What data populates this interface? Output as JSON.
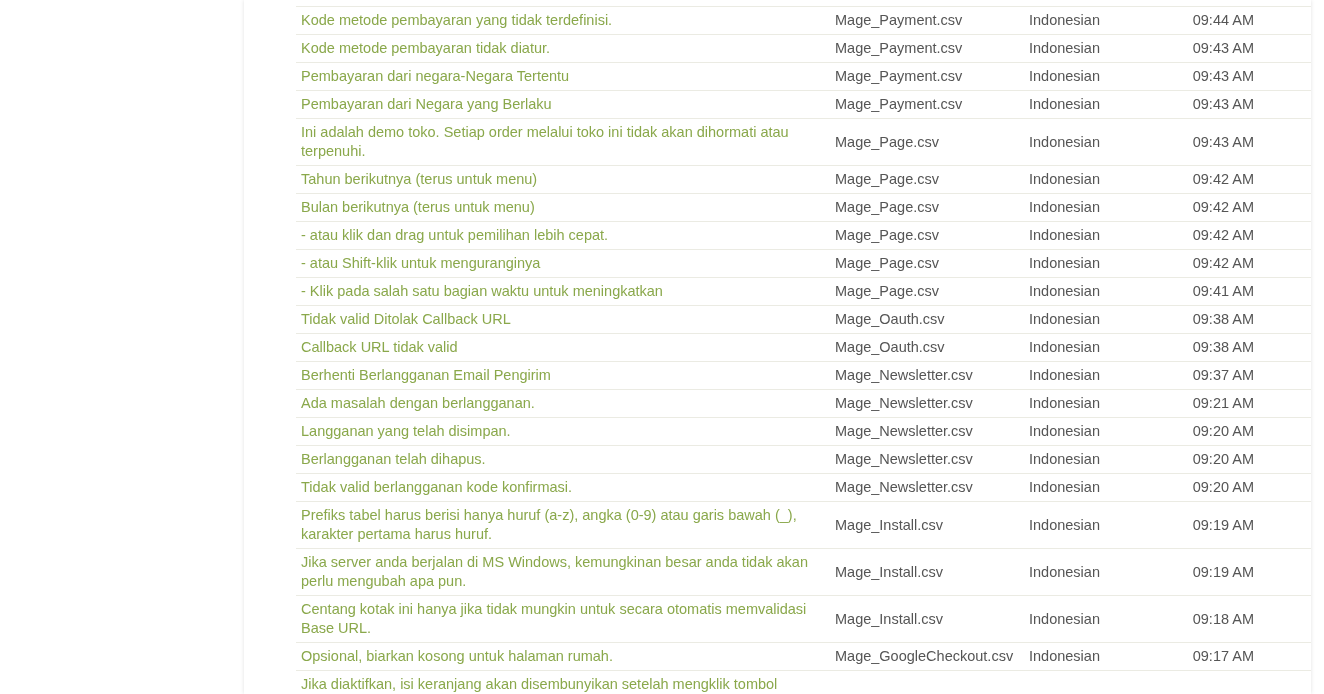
{
  "table": {
    "rows": [
      {
        "text": "Kode metode pembayaran yang tidak terdefinisi.",
        "file": "Mage_Payment.csv",
        "language": "Indonesian",
        "time": "09:44 AM"
      },
      {
        "text": "Kode metode pembayaran tidak diatur.",
        "file": "Mage_Payment.csv",
        "language": "Indonesian",
        "time": "09:43 AM"
      },
      {
        "text": "Pembayaran dari negara-Negara Tertentu",
        "file": "Mage_Payment.csv",
        "language": "Indonesian",
        "time": "09:43 AM"
      },
      {
        "text": "Pembayaran dari Negara yang Berlaku",
        "file": "Mage_Payment.csv",
        "language": "Indonesian",
        "time": "09:43 AM"
      },
      {
        "text": "Ini adalah demo toko. Setiap order melalui toko ini tidak akan dihormati atau terpenuhi.",
        "file": "Mage_Page.csv",
        "language": "Indonesian",
        "time": "09:43 AM"
      },
      {
        "text": "Tahun berikutnya (terus untuk menu)",
        "file": "Mage_Page.csv",
        "language": "Indonesian",
        "time": "09:42 AM"
      },
      {
        "text": "Bulan berikutnya (terus untuk menu)",
        "file": "Mage_Page.csv",
        "language": "Indonesian",
        "time": "09:42 AM"
      },
      {
        "text": "- atau klik dan drag untuk pemilihan lebih cepat.",
        "file": "Mage_Page.csv",
        "language": "Indonesian",
        "time": "09:42 AM"
      },
      {
        "text": "- atau Shift-klik untuk menguranginya",
        "file": "Mage_Page.csv",
        "language": "Indonesian",
        "time": "09:42 AM"
      },
      {
        "text": "- Klik pada salah satu bagian waktu untuk meningkatkan",
        "file": "Mage_Page.csv",
        "language": "Indonesian",
        "time": "09:41 AM"
      },
      {
        "text": "Tidak valid Ditolak Callback URL",
        "file": "Mage_Oauth.csv",
        "language": "Indonesian",
        "time": "09:38 AM"
      },
      {
        "text": "Callback URL tidak valid",
        "file": "Mage_Oauth.csv",
        "language": "Indonesian",
        "time": "09:38 AM"
      },
      {
        "text": "Berhenti Berlangganan Email Pengirim",
        "file": "Mage_Newsletter.csv",
        "language": "Indonesian",
        "time": "09:37 AM"
      },
      {
        "text": "Ada masalah dengan berlangganan.",
        "file": "Mage_Newsletter.csv",
        "language": "Indonesian",
        "time": "09:21 AM"
      },
      {
        "text": "Langganan yang telah disimpan.",
        "file": "Mage_Newsletter.csv",
        "language": "Indonesian",
        "time": "09:20 AM"
      },
      {
        "text": "Berlangganan telah dihapus.",
        "file": "Mage_Newsletter.csv",
        "language": "Indonesian",
        "time": "09:20 AM"
      },
      {
        "text": "Tidak valid berlangganan kode konfirmasi.",
        "file": "Mage_Newsletter.csv",
        "language": "Indonesian",
        "time": "09:20 AM"
      },
      {
        "text": "Prefiks tabel harus berisi hanya huruf (a-z), angka (0-9) atau garis bawah (_), karakter pertama harus huruf.",
        "file": "Mage_Install.csv",
        "language": "Indonesian",
        "time": "09:19 AM"
      },
      {
        "text": "Jika server anda berjalan di MS Windows, kemungkinan besar anda tidak akan perlu mengubah apa pun.",
        "file": "Mage_Install.csv",
        "language": "Indonesian",
        "time": "09:19 AM"
      },
      {
        "text": "Centang kotak ini hanya jika tidak mungkin untuk secara otomatis memvalidasi Base URL.",
        "file": "Mage_Install.csv",
        "language": "Indonesian",
        "time": "09:18 AM"
      },
      {
        "text": "Opsional, biarkan kosong untuk halaman rumah.",
        "file": "Mage_GoogleCheckout.csv",
        "language": "Indonesian",
        "time": "09:17 AM"
      },
      {
        "text": "Jika diaktifkan, isi keranjang akan disembunyikan setelah mengklik tombol"
      }
    ]
  }
}
